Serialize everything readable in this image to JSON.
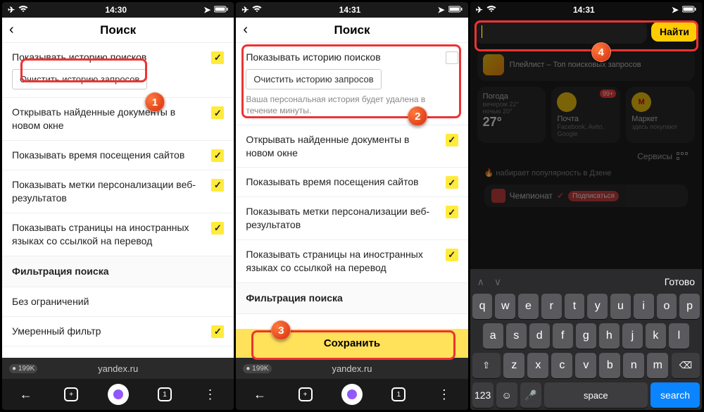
{
  "status": {
    "time_a": "14:30",
    "time_b": "14:31",
    "time_c": "14:31"
  },
  "header": {
    "title": "Поиск"
  },
  "settings": {
    "show_history": "Показывать историю поисков",
    "clear_history": "Очистить историю запросов",
    "clear_note": "Ваша персональная история будет удалена в течение минуты.",
    "open_new_window": "Открывать найденные документы в новом окне",
    "show_visit_time": "Показывать время посещения сайтов",
    "show_pers_labels": "Показывать метки персонализации веб-результатов",
    "show_foreign": "Показывать страницы на иностранных языках со ссылкой на перевод",
    "filter_section": "Фильтрация поиска",
    "no_restrict": "Без ограничений",
    "moderate": "Умеренный фильтр",
    "save": "Сохранить"
  },
  "browser": {
    "url": "yandex.ru",
    "badge": "● 199K",
    "tabs": "1"
  },
  "search": {
    "find": "Найти"
  },
  "widgets": {
    "playlist_title": "Плейлист – Топ поисковых запросов",
    "weather_t": "Погода",
    "weather_eve": "вечером 22°",
    "weather_night": "ночью 20°",
    "weather_temp": "27°",
    "mail_t": "Почта",
    "mail_s": "Facebook, Avito, Google",
    "mail_badge": "99+",
    "market_t": "Маркет",
    "market_s": "здесь покупают",
    "services": "Сервисы",
    "trend": "набирает популярность в Дзене",
    "card_name": "Чемпионат",
    "card_sub": "Подписаться"
  },
  "kbd": {
    "done": "Готово",
    "r1": [
      "q",
      "w",
      "e",
      "r",
      "t",
      "y",
      "u",
      "i",
      "o",
      "p"
    ],
    "r2": [
      "a",
      "s",
      "d",
      "f",
      "g",
      "h",
      "j",
      "k",
      "l"
    ],
    "r3": [
      "z",
      "x",
      "c",
      "v",
      "b",
      "n",
      "m"
    ],
    "num": "123",
    "space": "space",
    "search": "search"
  },
  "ann": {
    "n1": "1",
    "n2": "2",
    "n3": "3",
    "n4": "4"
  }
}
